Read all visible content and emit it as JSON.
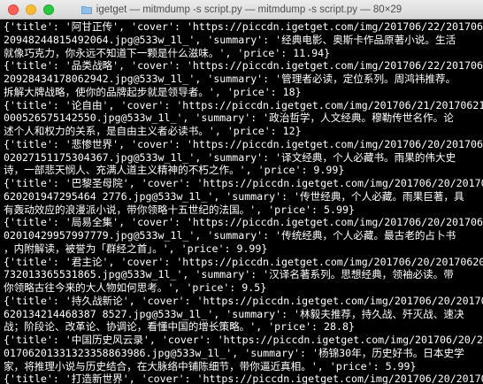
{
  "window": {
    "title": "igetget — mitmdump -s script.py — mitmdump -s script.py — 80×29"
  },
  "terminal": {
    "lines": [
      "{'title': '阿甘正传', 'cover': 'https://piccdn.igetget.com/img/201706/22/2017062",
      "20948244815492064.jpg@533w_1l_', 'summary': '经典电影、奥斯卡作品原著小说。生活",
      "就像巧克力，你永远不知道下一颗是什么滋味。', 'price': 11.94}",
      "{'title': '品类战略', 'cover': 'https://piccdn.igetget.com/img/201706/22/2017062",
      "20928434178062942.jpg@533w_1l_', 'summary': '管理者必读，定位系列。周鸿祎推荐。",
      "拆解大牌战略，使你的品牌起步就是领导者。', 'price': 18}",
      "{'title': '论自由', 'cover': 'https://piccdn.igetget.com/img/201706/21/201706211",
      "000526575142550.jpg@533w_1l_', 'summary': '政治哲学，人文经典。穆勒传世名作。论",
      "述个人和权力的关系，是自由主义者必读书。', 'price': 12}",
      "{'title': '悲惨世界', 'cover': 'https://piccdn.igetget.com/img/201706/20/2017062",
      "02027151175304367.jpg@533w_1l_', 'summary': '译文经典，个人必藏书。雨果的伟大史",
      "诗，一部悲天悯人、充满人道主义精神的不朽之作。', 'price': 9.99}",
      "{'title': '巴黎圣母院', 'cover': 'https://piccdn.igetget.com/img/201706/20/20170",
      "620201947295464 2776.jpg@533w_1l_', 'summary': '传世经典，个人必藏。雨果巨著，具",
      "有轰动效应的浪漫派小说，带你领略十五世纪的法国。', 'price': 5.99}",
      "{'title': '局易全集', 'cover': 'https://piccdn.igetget.com/img/201706/20/2017062",
      "02010429957997779.jpg@533w_1l_', 'summary': '传统经典，个人必藏。最古老的占卜书",
      "，内附解读，被誉为「群经之首」。', 'price': 9.99}",
      "{'title': '君主论', 'cover': 'https://piccdn.igetget.com/img/201706/20/201706201",
      "732013365531865.jpg@533w_1l_', 'summary': '汉译名著系列。思想经典，领袖必读。带",
      "你领略古往今来的大人物如何思考。', 'price': 9.5}",
      "{'title': '持久战新论', 'cover': 'https://piccdn.igetget.com/img/201706/20/20170",
      "620134214468387 8527.jpg@533w_1l_', 'summary': '林毅夫推荐，持久战、歼灭战、速决",
      "战；阶段论、改革论、协调论，看懂中国的增长策略。', 'price': 28.8}",
      "{'title': '中国历史风云录', 'cover': 'https://piccdn.igetget.com/img/201706/20/2",
      "01706201331323358863986.jpg@533w_1l_', 'summary': '杨锦30年，历史好书。日本史学",
      "家，将推理小说与历史结合，在大脉络中铺陈细节，带你逼近真相。', 'price': 5.99}",
      "{'title': '打造新世界', 'cover': 'https://piccdn.igetget.com/img/201706/20/20170",
      "620132058192 3656840.jpg@533w_1l_', 'summary': '公民读本，杨照作品。带你读懂美国"
    ]
  }
}
